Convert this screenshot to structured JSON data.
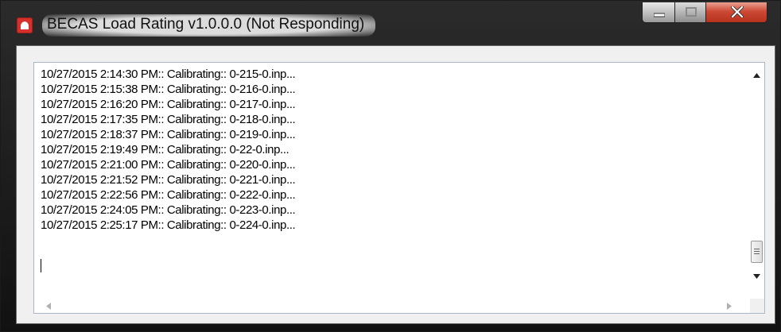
{
  "window": {
    "title": "BECAS Load Rating v1.0.0.0 (Not Responding)",
    "icon": "app-logo-icon",
    "controls": [
      "minimize-icon",
      "maximize-icon",
      "close-icon"
    ],
    "colors": {
      "close_button": "#c7402b",
      "app_icon": "#d5302b",
      "client_bg": "#f0f0f0",
      "textbox_border": "#a9b7c9"
    }
  },
  "log": {
    "lines": [
      "10/27/2015 2:14:30 PM:: Calibrating:: 0-215-0.inp...",
      "10/27/2015 2:15:38 PM:: Calibrating:: 0-216-0.inp...",
      "10/27/2015 2:16:20 PM:: Calibrating:: 0-217-0.inp...",
      "10/27/2015 2:17:35 PM:: Calibrating:: 0-218-0.inp...",
      "10/27/2015 2:18:37 PM:: Calibrating:: 0-219-0.inp...",
      "10/27/2015 2:19:49 PM:: Calibrating:: 0-22-0.inp...",
      "10/27/2015 2:21:00 PM:: Calibrating:: 0-220-0.inp...",
      "10/27/2015 2:21:52 PM:: Calibrating:: 0-221-0.inp...",
      "10/27/2015 2:22:56 PM:: Calibrating:: 0-222-0.inp...",
      "10/27/2015 2:24:05 PM:: Calibrating:: 0-223-0.inp...",
      "10/27/2015 2:25:17 PM:: Calibrating:: 0-224-0.inp..."
    ]
  },
  "scrollbars": {
    "vertical_position": 0.95,
    "icons": [
      "scroll-up-icon",
      "scroll-down-icon",
      "scroll-left-icon",
      "scroll-right-icon",
      "thumb-grip-icon"
    ]
  }
}
